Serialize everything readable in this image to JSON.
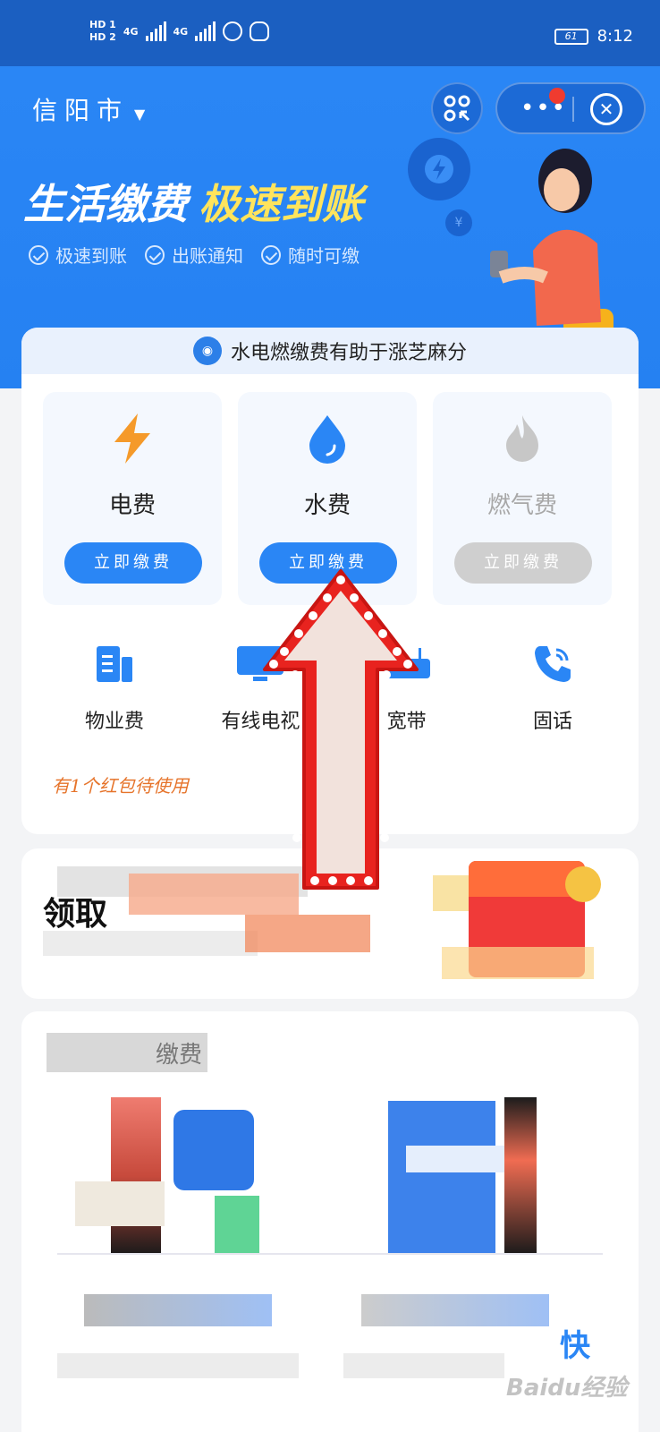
{
  "status_bar": {
    "hd1": "HD 1",
    "hd2": "HD 2",
    "net1": "4G",
    "net2": "4G",
    "battery": "61",
    "time": "8:12"
  },
  "header": {
    "city": "信阳市",
    "city_arrow": "▼",
    "headline_white": "生活缴费",
    "headline_yellow": "极速到账",
    "features": [
      "极速到账",
      "出账通知",
      "随时可缴"
    ],
    "bubble_b": "¥"
  },
  "banner": {
    "text": "水电燃缴费有助于涨芝麻分"
  },
  "tiles": [
    {
      "label": "电费",
      "button": "立即缴费",
      "enabled": true
    },
    {
      "label": "水费",
      "button": "立即缴费",
      "enabled": true
    },
    {
      "label": "燃气费",
      "button": "立即缴费",
      "enabled": false
    }
  ],
  "services": [
    {
      "label": "物业费"
    },
    {
      "label": "有线电视"
    },
    {
      "label": "宽带"
    },
    {
      "label": "固话"
    }
  ],
  "red_packet": "有1个红包待使用",
  "promo": {
    "title": "领取"
  },
  "bottom": {
    "heading": "缴费",
    "right_word": "快"
  },
  "watermark": "Baidu经验",
  "colors": {
    "brand_blue": "#2a86f5",
    "status_bar": "#1b5fc1",
    "accent_yellow": "#ffe45c",
    "electric_orange": "#f59a2a",
    "disabled_grey": "#cfcfcf",
    "red_dot": "#f03b2f"
  }
}
